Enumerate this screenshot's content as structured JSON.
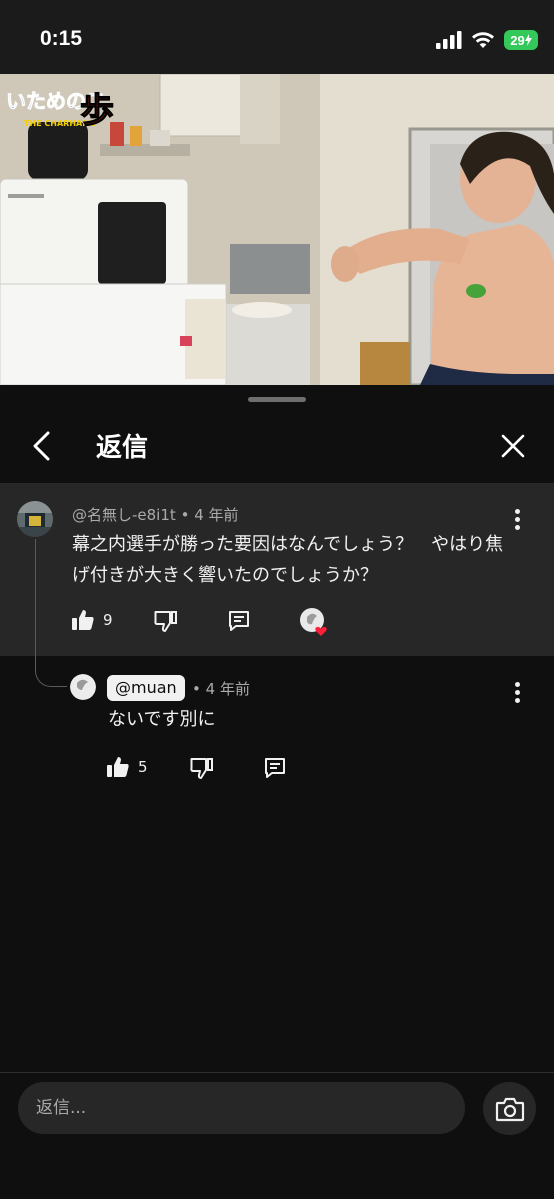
{
  "status_bar": {
    "time": "0:15",
    "battery": "29"
  },
  "video": {
    "logo_line1": "いためのス",
    "logo_line2": "THE CHARHANG",
    "logo_char": "歩"
  },
  "sheet": {
    "title": "返信"
  },
  "parent_comment": {
    "author": "@名無し-e8i1t",
    "separator": "•",
    "time": "4 年前",
    "text": "幕之内選手が勝った要因はなんでしょう？　やはり焦げ付きが大きく響いたのでしょうか？",
    "likes": "9"
  },
  "reply": {
    "author": "@muan",
    "separator": "•",
    "time": "4 年前",
    "text": "ないです別に",
    "likes": "5"
  },
  "input": {
    "placeholder": "返信..."
  }
}
